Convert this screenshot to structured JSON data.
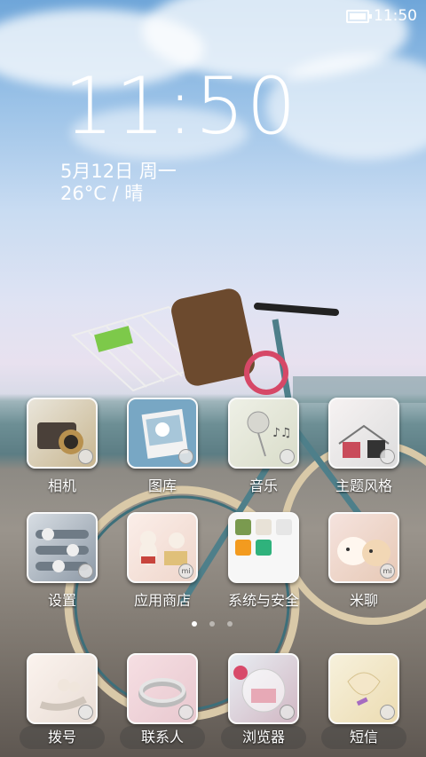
{
  "status_bar": {
    "time": "11:50",
    "battery_icon": "battery-icon"
  },
  "lock_widget": {
    "clock": "11:50",
    "date": "5月12日 周一",
    "weather": "26°C / 晴"
  },
  "apps": [
    {
      "label": "相机",
      "icon": "camera-icon"
    },
    {
      "label": "图库",
      "icon": "gallery-icon"
    },
    {
      "label": "音乐",
      "icon": "music-icon"
    },
    {
      "label": "主题风格",
      "icon": "theme-icon"
    },
    {
      "label": "设置",
      "icon": "settings-icon"
    },
    {
      "label": "应用商店",
      "icon": "app-store-icon"
    },
    {
      "label": "系统与安全",
      "icon": "security-folder-icon"
    },
    {
      "label": "米聊",
      "icon": "miliao-icon"
    }
  ],
  "page_indicator": {
    "pages": 3,
    "current": 1
  },
  "dock": [
    {
      "label": "拨号",
      "icon": "dialer-icon"
    },
    {
      "label": "联系人",
      "icon": "contacts-icon"
    },
    {
      "label": "浏览器",
      "icon": "browser-icon"
    },
    {
      "label": "短信",
      "icon": "messages-icon"
    }
  ],
  "badge_mi": "mi"
}
